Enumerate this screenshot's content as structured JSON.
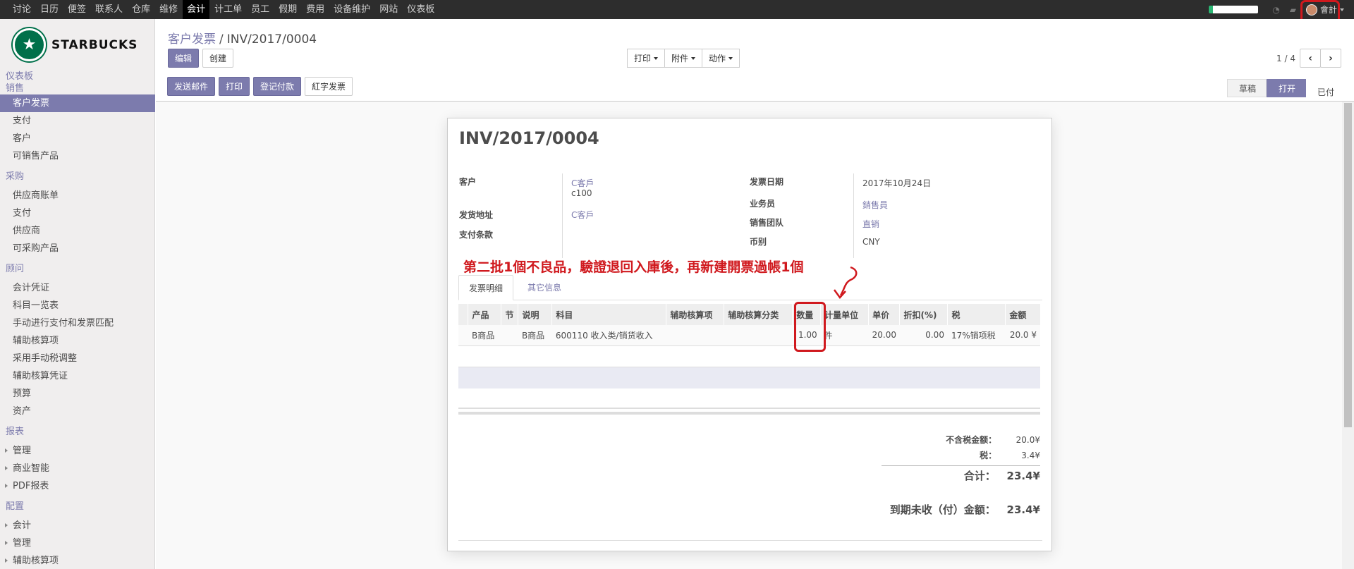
{
  "topbar": {
    "menu": [
      "讨论",
      "日历",
      "便签",
      "联系人",
      "仓库",
      "维修",
      "会计",
      "计工单",
      "员工",
      "假期",
      "费用",
      "设备维护",
      "网站",
      "仪表板"
    ],
    "active_menu": "会计",
    "user_name": "會計"
  },
  "sidebar": {
    "logo_text": "STARBUCKS",
    "sections": [
      {
        "title": "仪表板",
        "items": []
      },
      {
        "title": "销售",
        "items": [
          "客户发票",
          "支付",
          "客户",
          "可销售产品"
        ]
      },
      {
        "title": "采购",
        "items": [
          "供应商账单",
          "支付",
          "供应商",
          "可采购产品"
        ]
      },
      {
        "title": "顾问",
        "items": [
          "会计凭证",
          "科目一览表",
          "手动进行支付和发票匹配",
          "辅助核算项",
          "采用手动税调整",
          "辅助核算凭证",
          "预算",
          "资产"
        ]
      },
      {
        "title": "报表",
        "items": [
          "管理",
          "商业智能",
          "PDF报表"
        ]
      },
      {
        "title": "配置",
        "items": [
          "会计",
          "管理",
          "辅助核算项"
        ]
      }
    ],
    "active_item": "客户发票"
  },
  "breadcrumb": {
    "parent": "客户发票",
    "separator": "/",
    "current": "INV/2017/0004"
  },
  "buttons": {
    "edit": "编辑",
    "create": "创建"
  },
  "actions": {
    "print": "打印",
    "attachment": "附件",
    "action": "动作"
  },
  "pager": {
    "value": "1 / 4",
    "prev": "‹",
    "next": "›"
  },
  "header_buttons": {
    "send_email": "发送邮件",
    "print": "打印",
    "register_payment": "登记付款",
    "credit_note": "紅字发票"
  },
  "status": {
    "draft": "草稿",
    "open": "打开",
    "paid": "已付"
  },
  "invoice": {
    "number": "INV/2017/0004",
    "customer_label": "客户",
    "customer": "C客戶",
    "customer_code": "c100",
    "delivery_label": "发货地址",
    "delivery": "C客戶",
    "terms_label": "支付条款",
    "date_label": "发票日期",
    "date": "2017年10月24日",
    "salesperson_label": "业务员",
    "salesperson": "銷售員",
    "team_label": "销售团队",
    "team": "直销",
    "currency_label": "币别",
    "currency": "CNY"
  },
  "annotation": "第二批1個不良品，驗證退回入庫後，再新建開票過帳1個",
  "tabs": [
    "发票明细",
    "其它信息"
  ],
  "table": {
    "headers": [
      "产品",
      "节",
      "说明",
      "科目",
      "辅助核算项",
      "辅助核算分类",
      "数量",
      "计量单位",
      "单价",
      "折扣(%)",
      "税",
      "金额"
    ],
    "rows": [
      {
        "product": "B商品",
        "section": "",
        "desc": "B商品",
        "account": "600110 收入类/销货收入",
        "analytic": "",
        "analytic_tag": "",
        "qty": "1.00",
        "uom": "件",
        "price": "20.00",
        "discount": "0.00",
        "tax": "17%销项税",
        "amount": "20.0 ¥"
      }
    ]
  },
  "totals": {
    "untaxed_label": "不含税金额：",
    "untaxed": "20.0¥",
    "tax_label": "税：",
    "tax": "3.4¥",
    "total_label": "合计：",
    "total": "23.4¥",
    "due_label": "到期未收（付）金额：",
    "due": "23.4¥"
  }
}
